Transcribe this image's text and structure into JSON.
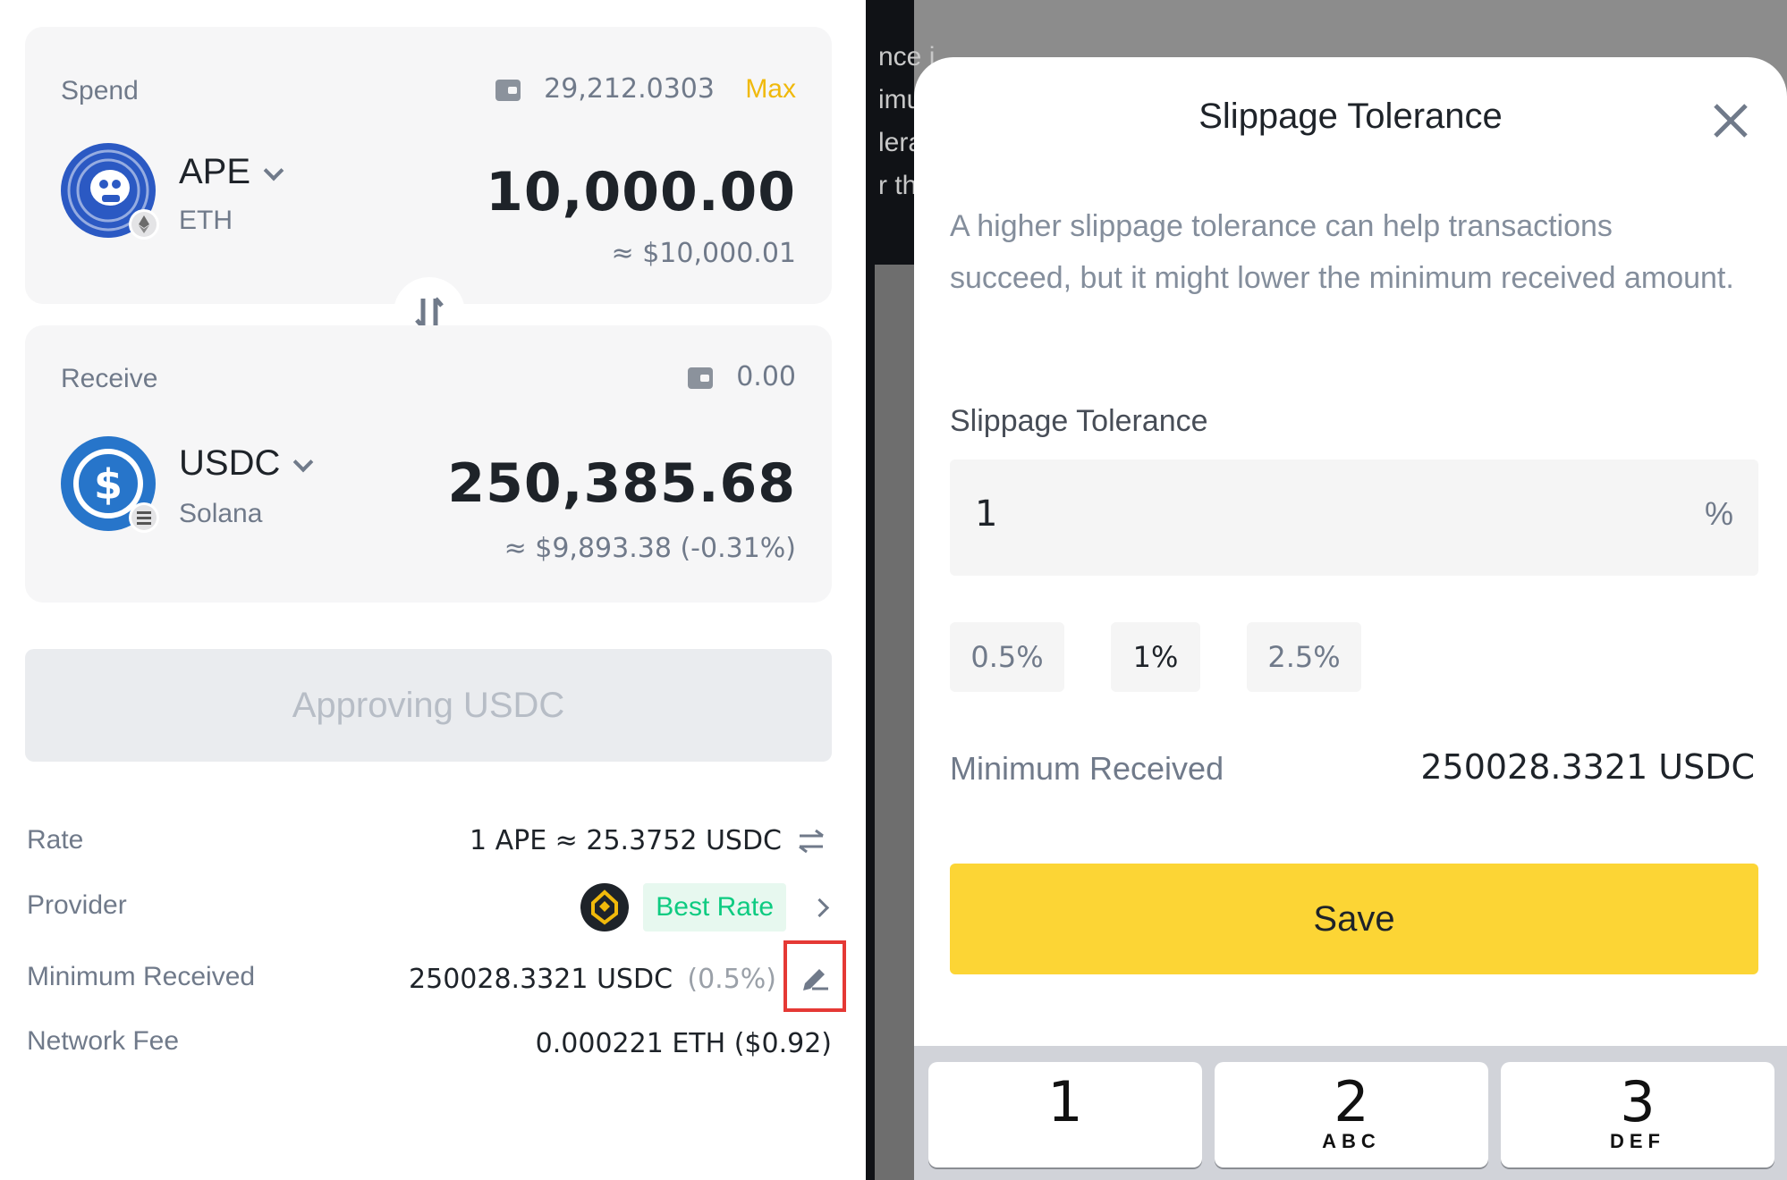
{
  "spend": {
    "label": "Spend",
    "balance": "29,212.0303",
    "max_label": "Max",
    "coin": "APE",
    "network": "ETH",
    "amount": "10,000.00",
    "usd_value": "≈ $10,000.01"
  },
  "receive": {
    "label": "Receive",
    "balance": "0.00",
    "coin": "USDC",
    "network": "Solana",
    "amount": "250,385.68",
    "usd_value": "≈ $9,893.38 (-0.31%)"
  },
  "action_button": "Approving USDC",
  "details": {
    "rate_label": "Rate",
    "rate_value": "1 APE ≈ 25.3752 USDC",
    "provider_label": "Provider",
    "provider_badge": "Best Rate",
    "min_received_label": "Minimum Received",
    "min_received_value": "250028.3321 USDC",
    "min_received_pct": "(0.5%)",
    "network_fee_label": "Network Fee",
    "network_fee_value": "0.000221 ETH ($0.92)"
  },
  "behind_text": [
    "nce i",
    "imu",
    "lera",
    "r the"
  ],
  "modal": {
    "title": "Slippage Tolerance",
    "description": "A higher slippage tolerance can help transactions succeed, but it might lower the minimum received amount.",
    "field_label": "Slippage Tolerance",
    "input_value": "1",
    "unit": "%",
    "options": [
      "0.5%",
      "1%",
      "2.5%"
    ],
    "selected_option": "1%",
    "min_received_label": "Minimum Received",
    "min_received_value": "250028.3321 USDC",
    "save_label": "Save"
  },
  "keypad": [
    {
      "digit": "1",
      "letters": ""
    },
    {
      "digit": "2",
      "letters": "ABC"
    },
    {
      "digit": "3",
      "letters": "DEF"
    }
  ],
  "colors": {
    "accent": "#FCD535",
    "max_link": "#F0B90B",
    "badge_green": "#0ECB81",
    "highlight_box": "#E53935",
    "coin_blue": "#2775CA"
  }
}
